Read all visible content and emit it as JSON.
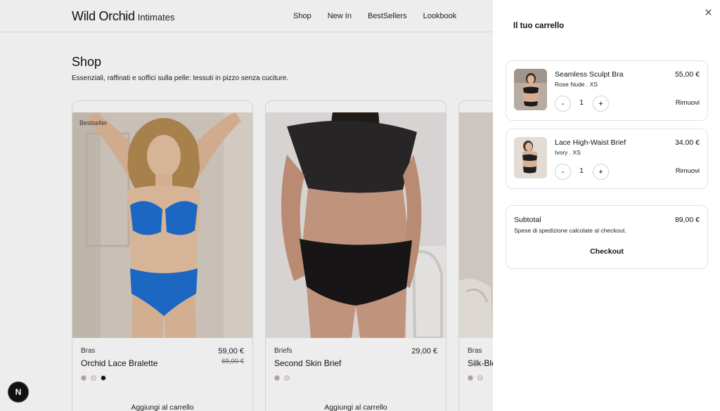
{
  "brand": {
    "name": "Wild Orchid",
    "tagline": "Intimates"
  },
  "nav": [
    "Shop",
    "New In",
    "BestSellers",
    "Lookbook"
  ],
  "shop": {
    "title": "Shop",
    "subtitle": "Essenziali, raffinati e soffici sulla pelle: tessuti in pizzo senza cuciture."
  },
  "products": [
    {
      "badge": "Bestseller",
      "category": "Bras",
      "name": "Orchid Lace Bralette",
      "price": "59,00 €",
      "old_price": "69,00 €",
      "swatches": [
        "#c9a3a0",
        "#e6e6e6",
        "#111111"
      ],
      "add_label": "Aggiungi al carrello"
    },
    {
      "badge": "",
      "category": "Briefs",
      "name": "Second Skin Brief",
      "price": "29,00 €",
      "old_price": "",
      "swatches": [
        "#c9a3a0",
        "#e6e6e6"
      ],
      "add_label": "Aggiungi al carrello"
    },
    {
      "badge": "",
      "category": "Bras",
      "name": "Silk-Ble",
      "price": "",
      "old_price": "",
      "swatches": [
        "#c9a3a0",
        "#e6e6e6"
      ],
      "add_label": ""
    }
  ],
  "cart": {
    "title": "Il tuo carrello",
    "close_icon": "close-icon",
    "items": [
      {
        "name": "Seamless Sculpt Bra",
        "variant": "Rose Nude . XS",
        "price": "55,00 €",
        "qty": "1",
        "minus": "-",
        "plus": "+",
        "remove": "Rimuovi"
      },
      {
        "name": "Lace High-Waist Brief",
        "variant": "Ivory . XS",
        "price": "34,00 €",
        "qty": "1",
        "minus": "-",
        "plus": "+",
        "remove": "Rimuovi"
      }
    ],
    "subtotal_label": "Subtotal",
    "subtotal_value": "89,00 €",
    "shipping_note": "Spese di spedizione calcolate al checkout.",
    "checkout_label": "Checkout"
  },
  "dev_badge": "N"
}
